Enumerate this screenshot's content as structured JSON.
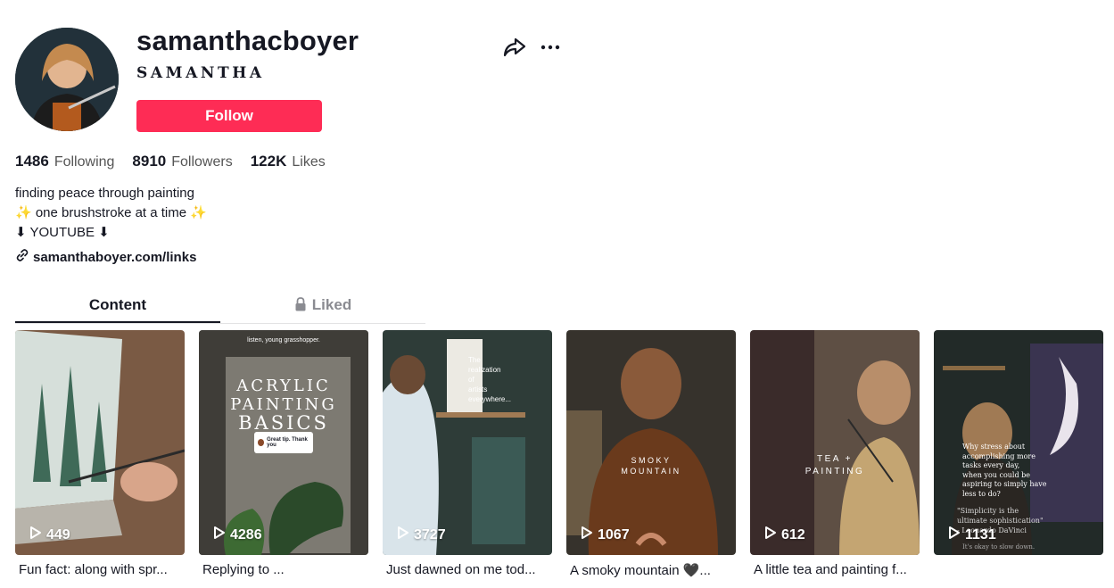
{
  "profile": {
    "username": "samanthacboyer",
    "display_name": "SAMANTHA",
    "follow_label": "Follow",
    "stats": [
      {
        "value": "1486",
        "label": "Following"
      },
      {
        "value": "8910",
        "label": "Followers"
      },
      {
        "value": "122K",
        "label": "Likes"
      }
    ],
    "bio_lines": [
      "finding peace through painting",
      "✨ one brushstroke at a time ✨",
      "⬇ YOUTUBE ⬇"
    ],
    "link": "samanthaboyer.com/links"
  },
  "tabs": {
    "content": "Content",
    "liked": "Liked"
  },
  "videos": [
    {
      "views": "449",
      "caption": "Fun fact: along with spr...",
      "colors": [
        "#6b4a3a",
        "#c9d6d2"
      ]
    },
    {
      "views": "4286",
      "caption": "Replying to ...",
      "colors": [
        "#3d3b36",
        "#8c8a84"
      ],
      "overlay_top": "listen, young grasshopper.",
      "overlay_title": [
        "ACRYLIC",
        "PAINTING",
        "BASICS"
      ],
      "overlay_bubble": "Great tip. Thank you"
    },
    {
      "views": "3727",
      "caption": "Just dawned on me tod...",
      "colors": [
        "#2c3a37",
        "#6f7d73"
      ],
      "overlay_text": [
        "The",
        "realization",
        "of",
        "artists",
        "everywhere..."
      ]
    },
    {
      "views": "1067",
      "caption": "A smoky mountain 🖤...",
      "colors": [
        "#3a2a20",
        "#7a4a2a"
      ],
      "overlay_text": [
        "SMOKY",
        "MOUNTAIN"
      ]
    },
    {
      "views": "612",
      "caption": "A little tea and painting f...",
      "colors": [
        "#3c2b2b",
        "#6a5a4c"
      ],
      "overlay_text": [
        "TEA +",
        "PAINTING"
      ]
    },
    {
      "views": "1131",
      "caption": "",
      "colors": [
        "#1f2a2a",
        "#4a3b5a"
      ],
      "overlay_text": [
        "Why stress about",
        "accomplishing more",
        "tasks every day,",
        "when you could be",
        "aspiring to simply have",
        "less to do?"
      ],
      "overlay_quote": [
        "\"Simplicity is the",
        "ultimate sophistication\"",
        "- Leonardo DaVinci"
      ],
      "overlay_foot": "It's okay to slow down."
    }
  ]
}
